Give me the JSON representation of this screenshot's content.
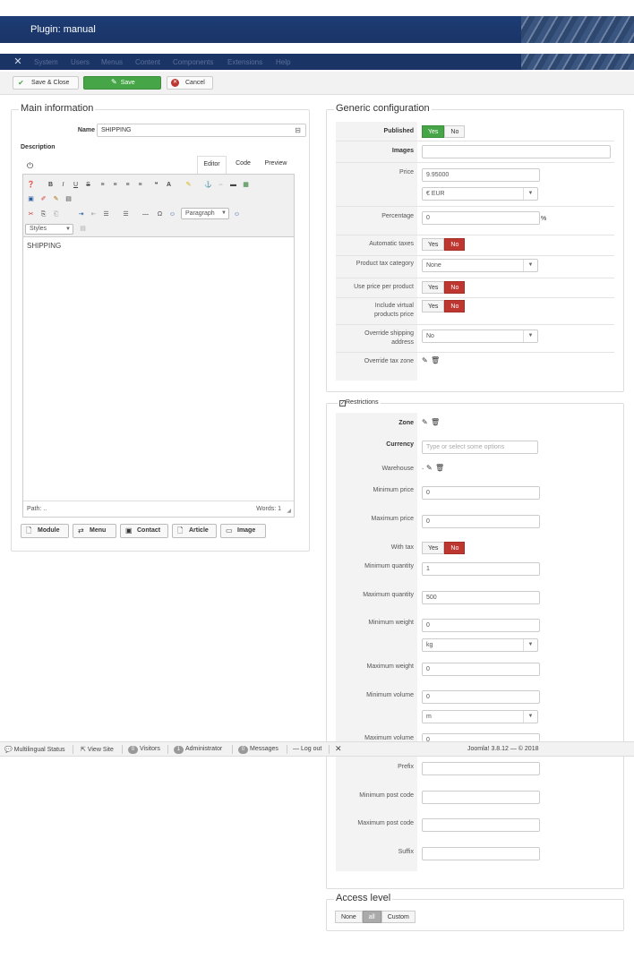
{
  "header": {
    "title": "Plugin: manual"
  },
  "menubar": {
    "items": [
      "System",
      "Users",
      "Menus",
      "Content",
      "Components",
      "Extensions",
      "Help"
    ]
  },
  "toolbar": {
    "save_close": "Save & Close",
    "save": "Save",
    "cancel": "Cancel"
  },
  "main_info": {
    "legend": "Main information",
    "name_label": "Name",
    "name_value": "SHIPPING",
    "description_label": "Description",
    "tabs": [
      "Editor",
      "Code",
      "Preview"
    ],
    "format_select": "Paragraph",
    "styles_select": "Styles",
    "content": "SHIPPING",
    "path_label": "Path: ..",
    "words": "Words: 1",
    "buttons": [
      "Module",
      "Menu",
      "Contact",
      "Article",
      "Image"
    ]
  },
  "generic": {
    "legend": "Generic configuration",
    "published_label": "Published",
    "images_label": "Images",
    "price_label": "Price",
    "price_value": "9.95000",
    "currency_value": "€ EUR",
    "percentage_label": "Percentage",
    "percentage_value": "0",
    "percent_sign": "%",
    "auto_taxes_label": "Automatic taxes",
    "tax_category_label": "Product tax category",
    "tax_category_value": "None",
    "price_per_product_label": "Use price per product",
    "virtual_label": "Include virtual products price",
    "override_shipping_label": "Override shipping address",
    "override_shipping_value": "No",
    "override_tax_label": "Override tax zone",
    "yes": "Yes",
    "no": "No"
  },
  "restrictions": {
    "legend": "Restrictions",
    "zone_label": "Zone",
    "currency_label": "Currency",
    "currency_placeholder": "Type or select some options",
    "warehouse_label": "Warehouse",
    "warehouse_prefix": ".",
    "min_price_label": "Minimum price",
    "min_price_value": "0",
    "max_price_label": "Maximum price",
    "max_price_value": "0",
    "with_tax_label": "With tax",
    "min_qty_label": "Minimum quantity",
    "min_qty_value": "1",
    "max_qty_label": "Maximum quantity",
    "max_qty_value": "500",
    "min_weight_label": "Minimum weight",
    "min_weight_value": "0",
    "weight_unit": "kg",
    "max_weight_label": "Maximum weight",
    "max_weight_value": "0",
    "min_volume_label": "Minimum volume",
    "min_volume_value": "0",
    "volume_unit": "m",
    "max_volume_label": "Maximum volume",
    "max_volume_value": "0",
    "prefix_label": "Prefix",
    "min_post_label": "Minimum post code",
    "max_post_label": "Maximum post code",
    "suffix_label": "Suffix"
  },
  "access": {
    "legend": "Access level",
    "none": "None",
    "all": "all",
    "custom": "Custom"
  },
  "statusbar": {
    "multilingual": "Multilingual Status",
    "view_site": "View Site",
    "visitors_count": "0",
    "visitors": "Visitors",
    "admin_count": "1",
    "admin": "Administrator",
    "messages_count": "0",
    "messages": "Messages",
    "logout": "Log out",
    "version": "Joomla! 3.8.12 — © 2018"
  },
  "colors": {
    "header": "#1a3466",
    "green": "#46a546",
    "red": "#bd362f"
  }
}
